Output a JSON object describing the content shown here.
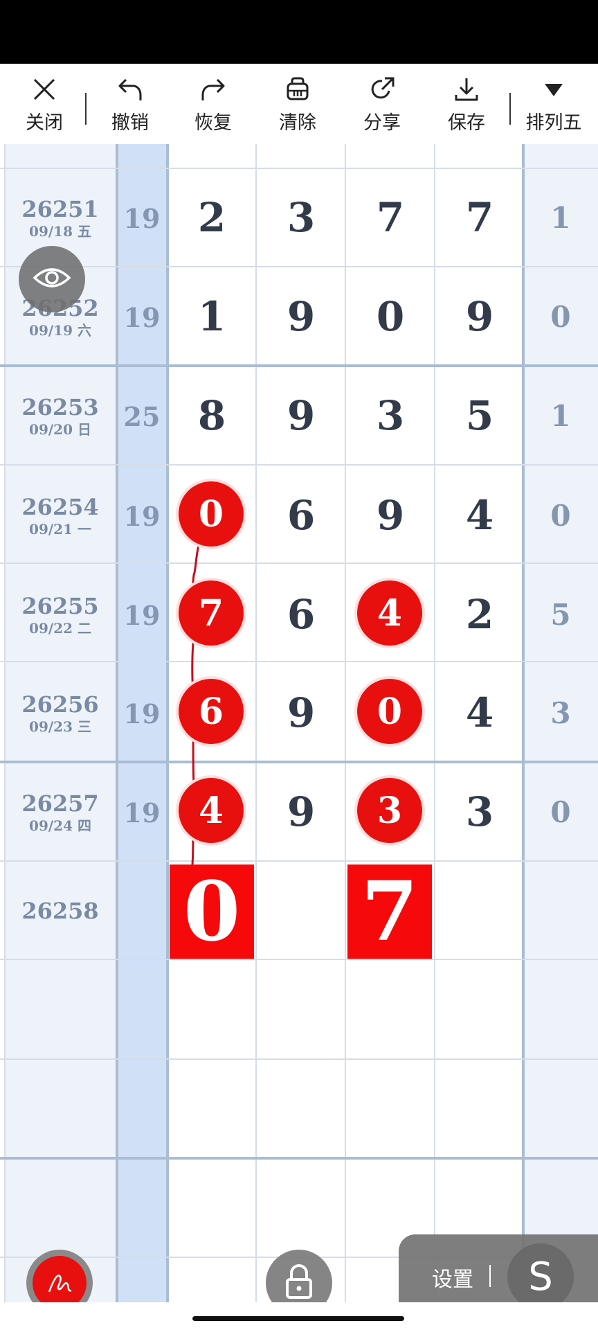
{
  "toolbar": {
    "close_label": "关闭",
    "undo_label": "撤销",
    "redo_label": "恢复",
    "clear_label": "清除",
    "share_label": "分享",
    "save_label": "保存",
    "mode_label": "排列五"
  },
  "rows": [
    {
      "issue": "26251",
      "date": "09/18 五",
      "sum": "19",
      "digits": [
        "2",
        "3",
        "7",
        "7"
      ],
      "last": "1"
    },
    {
      "issue": "26252",
      "date": "09/19 六",
      "sum": "19",
      "digits": [
        "1",
        "9",
        "0",
        "9"
      ],
      "last": "0"
    },
    {
      "issue": "26253",
      "date": "09/20 日",
      "sum": "25",
      "digits": [
        "8",
        "9",
        "3",
        "5"
      ],
      "last": "1"
    },
    {
      "issue": "26254",
      "date": "09/21 一",
      "sum": "19",
      "digits": [
        "0",
        "6",
        "9",
        "4"
      ],
      "last": "0"
    },
    {
      "issue": "26255",
      "date": "09/22 二",
      "sum": "19",
      "digits": [
        "7",
        "6",
        "4",
        "2"
      ],
      "last": "5"
    },
    {
      "issue": "26256",
      "date": "09/23 三",
      "sum": "19",
      "digits": [
        "6",
        "9",
        "0",
        "4"
      ],
      "last": "3"
    },
    {
      "issue": "26257",
      "date": "09/24 四",
      "sum": "19",
      "digits": [
        "4",
        "9",
        "3",
        "3"
      ],
      "last": "0"
    },
    {
      "issue": "26258",
      "date": "",
      "sum": "",
      "digits": [
        "0",
        "",
        "7",
        ""
      ],
      "last": ""
    }
  ],
  "prediction": {
    "col1": "0",
    "col3": "7"
  },
  "settings": {
    "label": "设置",
    "s_label": "S"
  },
  "colors": {
    "accent_red": "#e8100f",
    "column_blue": "#cfe0f7",
    "side_column": "#eef3fa"
  },
  "icons": [
    "close-icon",
    "undo-icon",
    "redo-icon",
    "clear-icon",
    "share-icon",
    "save-icon",
    "dropdown-icon",
    "eye-icon",
    "pen-icon",
    "lock-icon"
  ]
}
